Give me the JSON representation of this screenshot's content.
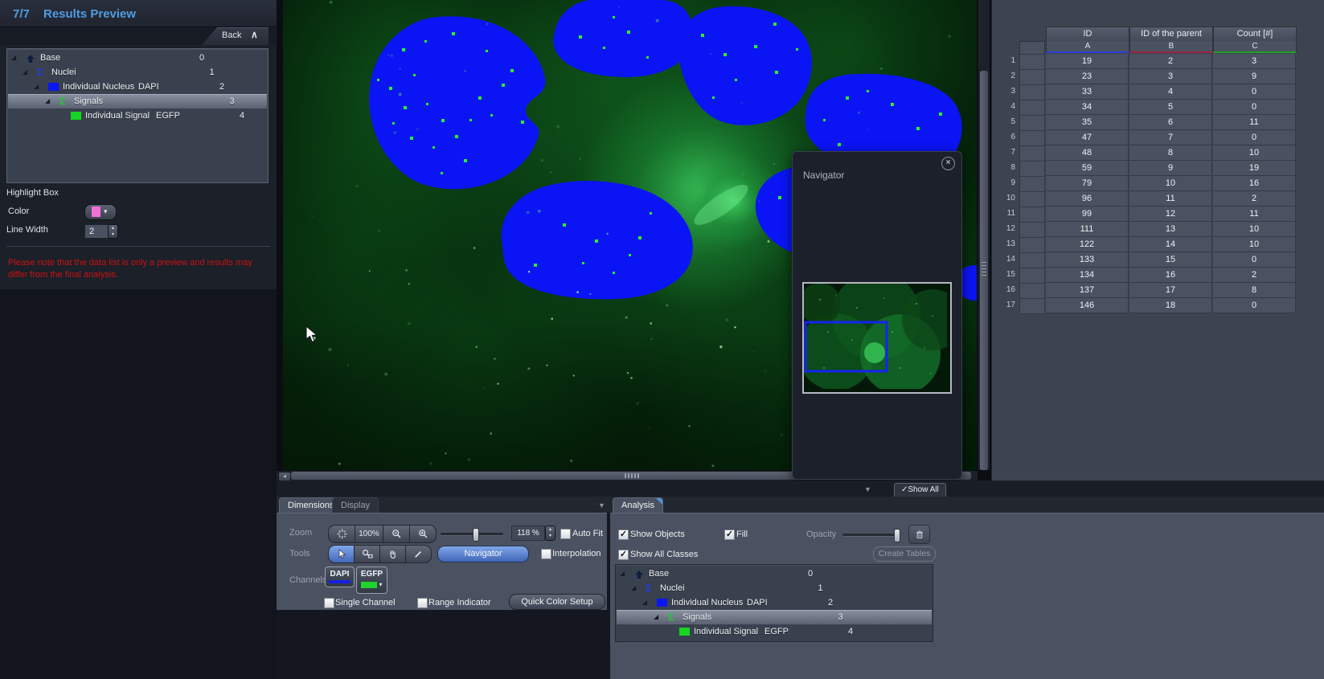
{
  "header": {
    "step": "7/7",
    "title": "Results Preview",
    "back": "Back"
  },
  "class_tree": {
    "rows": [
      {
        "icon": "base",
        "label": "Base",
        "tag": "",
        "count": "0",
        "expander": true,
        "selected": false
      },
      {
        "icon": "sigma-blue",
        "label": "Nuclei",
        "tag": "",
        "count": "1",
        "expander": true,
        "selected": false
      },
      {
        "icon": "square-blue",
        "label": "Individual Nucleus",
        "tag": "DAPI",
        "count": "2",
        "expander": true,
        "selected": false
      },
      {
        "icon": "sigma-green",
        "label": "Signals",
        "tag": "",
        "count": "3",
        "expander": true,
        "selected": true
      },
      {
        "icon": "square-green",
        "label": "Individual Signal",
        "tag": "EGFP",
        "count": "4",
        "expander": false,
        "selected": false
      }
    ]
  },
  "highlight_box": {
    "title": "Highlight Box",
    "color_label": "Color",
    "color_value": "#f26fd8",
    "line_width_label": "Line Width",
    "line_width_value": "2"
  },
  "warning": "Please note that the data list is only a preview and results may differ from the final analysis.",
  "navigator": {
    "title": "Navigator"
  },
  "results_table": {
    "columns": [
      "ID",
      "ID of the parent",
      "Count [#]"
    ],
    "bands": [
      "A",
      "B",
      "C"
    ],
    "band_colors": [
      "#2b3fd6",
      "#a02343",
      "#21a226"
    ],
    "rows": [
      [
        19,
        2,
        3
      ],
      [
        23,
        3,
        9
      ],
      [
        33,
        4,
        0
      ],
      [
        34,
        5,
        0
      ],
      [
        35,
        6,
        11
      ],
      [
        47,
        7,
        0
      ],
      [
        48,
        8,
        10
      ],
      [
        59,
        9,
        19
      ],
      [
        79,
        10,
        16
      ],
      [
        96,
        11,
        2
      ],
      [
        99,
        12,
        11
      ],
      [
        111,
        13,
        10
      ],
      [
        122,
        14,
        10
      ],
      [
        133,
        15,
        0
      ],
      [
        134,
        16,
        2
      ],
      [
        137,
        17,
        8
      ],
      [
        146,
        18,
        0
      ]
    ]
  },
  "dimensions": {
    "tab_dimensions": "Dimensions",
    "tab_display": "Display",
    "zoom_label": "Zoom",
    "btn_100": "100%",
    "zoom_value": "118 %",
    "auto_fit": "Auto Fit",
    "auto_fit_checked": false,
    "tools_label": "Tools",
    "navigator_button": "Navigator",
    "interpolation": "Interpolation",
    "interpolation_checked": false,
    "channels_label": "Channels",
    "channel_1": "DAPI",
    "channel_2": "EGFP",
    "channel_1_color": "#1520e8",
    "channel_2_color": "#1fd42c",
    "single_channel": "Single Channel",
    "single_channel_checked": false,
    "range_indicator": "Range Indicator",
    "range_indicator_checked": false,
    "quick_color_setup": "Quick Color Setup"
  },
  "analysis": {
    "tab": "Analysis",
    "show_objects": "Show Objects",
    "show_objects_checked": true,
    "fill": "Fill",
    "fill_checked": true,
    "opacity_label": "Opacity",
    "show_all_classes": "Show All Classes",
    "show_all_classes_checked": true,
    "create_tables": "Create Tables",
    "show_all": "Show All",
    "show_all_checked": true
  }
}
